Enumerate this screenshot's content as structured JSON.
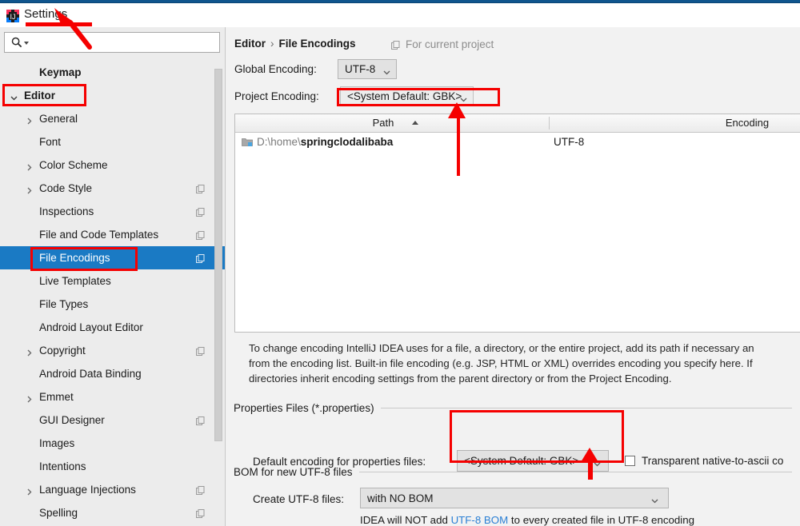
{
  "window": {
    "title": "Settings",
    "app_icon": "intellij-idea-icon"
  },
  "sidebar": {
    "search": {
      "placeholder": "",
      "value": "",
      "icon": "search-icon"
    },
    "items": [
      {
        "label": "Keymap",
        "indent": 1,
        "twisty": "none",
        "copy": false,
        "selected": false,
        "bold": true
      },
      {
        "label": "Editor",
        "indent": 0,
        "twisty": "expanded",
        "copy": false,
        "selected": false,
        "bold": true
      },
      {
        "label": "General",
        "indent": 1,
        "twisty": "collapsed",
        "copy": false,
        "selected": false,
        "bold": false
      },
      {
        "label": "Font",
        "indent": 1,
        "twisty": "none",
        "copy": false,
        "selected": false,
        "bold": false
      },
      {
        "label": "Color Scheme",
        "indent": 1,
        "twisty": "collapsed",
        "copy": false,
        "selected": false,
        "bold": false
      },
      {
        "label": "Code Style",
        "indent": 1,
        "twisty": "collapsed",
        "copy": true,
        "selected": false,
        "bold": false
      },
      {
        "label": "Inspections",
        "indent": 1,
        "twisty": "none",
        "copy": true,
        "selected": false,
        "bold": false
      },
      {
        "label": "File and Code Templates",
        "indent": 1,
        "twisty": "none",
        "copy": true,
        "selected": false,
        "bold": false
      },
      {
        "label": "File Encodings",
        "indent": 1,
        "twisty": "none",
        "copy": true,
        "selected": true,
        "bold": false
      },
      {
        "label": "Live Templates",
        "indent": 1,
        "twisty": "none",
        "copy": false,
        "selected": false,
        "bold": false
      },
      {
        "label": "File Types",
        "indent": 1,
        "twisty": "none",
        "copy": false,
        "selected": false,
        "bold": false
      },
      {
        "label": "Android Layout Editor",
        "indent": 1,
        "twisty": "none",
        "copy": false,
        "selected": false,
        "bold": false
      },
      {
        "label": "Copyright",
        "indent": 1,
        "twisty": "collapsed",
        "copy": true,
        "selected": false,
        "bold": false
      },
      {
        "label": "Android Data Binding",
        "indent": 1,
        "twisty": "none",
        "copy": false,
        "selected": false,
        "bold": false
      },
      {
        "label": "Emmet",
        "indent": 1,
        "twisty": "collapsed",
        "copy": false,
        "selected": false,
        "bold": false
      },
      {
        "label": "GUI Designer",
        "indent": 1,
        "twisty": "none",
        "copy": true,
        "selected": false,
        "bold": false
      },
      {
        "label": "Images",
        "indent": 1,
        "twisty": "none",
        "copy": false,
        "selected": false,
        "bold": false
      },
      {
        "label": "Intentions",
        "indent": 1,
        "twisty": "none",
        "copy": false,
        "selected": false,
        "bold": false
      },
      {
        "label": "Language Injections",
        "indent": 1,
        "twisty": "collapsed",
        "copy": true,
        "selected": false,
        "bold": false
      },
      {
        "label": "Spelling",
        "indent": 1,
        "twisty": "none",
        "copy": true,
        "selected": false,
        "bold": false
      }
    ]
  },
  "main": {
    "breadcrumb": {
      "parent": "Editor",
      "separator": "›",
      "current": "File Encodings"
    },
    "for_current_project": "For current project",
    "global_encoding": {
      "label": "Global Encoding:",
      "value": "UTF-8"
    },
    "project_encoding": {
      "label": "Project Encoding:",
      "value": "<System Default: GBK>"
    },
    "table": {
      "columns": [
        "Path",
        "Encoding"
      ],
      "sort_column": "Path",
      "sort_direction": "asc",
      "rows": [
        {
          "path_prefix": "D:\\home\\",
          "path_name": "springclodalibaba",
          "encoding": "UTF-8"
        }
      ]
    },
    "description": [
      "To change encoding IntelliJ IDEA uses for a file, a directory, or the entire project, add its path if necessary an",
      "from the encoding list. Built-in file encoding (e.g. JSP, HTML or XML) overrides encoding you specify here. If",
      "directories inherit encoding settings from the parent directory or from the Project Encoding."
    ],
    "properties_group": {
      "title": "Properties Files (*.properties)",
      "default_encoding_label": "Default encoding for properties files:",
      "default_encoding_value": "<System Default: GBK>",
      "transparent_checkbox_label": "Transparent native-to-ascii co",
      "transparent_checked": false
    },
    "bom_group": {
      "title": "BOM for new UTF-8 files",
      "create_label": "Create UTF-8 files:",
      "create_value": "with NO BOM",
      "hint_before": "IDEA will NOT add ",
      "hint_link": "UTF-8 BOM",
      "hint_after": " to every created file in UTF-8 encoding"
    }
  },
  "annotations": {
    "color": "#f50000",
    "items": [
      "underline-settings-title",
      "arrow-to-settings-title",
      "box-editor-tree-item",
      "box-file-encodings-tree-item",
      "box-project-encoding-combo",
      "arrow-to-project-encoding",
      "box-default-properties-encoding",
      "arrow-to-default-properties-encoding"
    ]
  }
}
